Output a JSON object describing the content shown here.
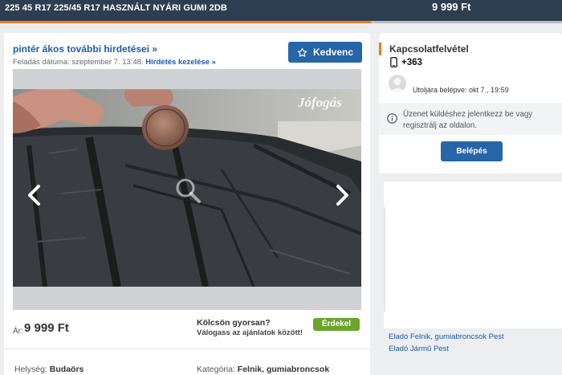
{
  "header": {
    "title": "225 45 R17 225/45 R17 HASZNÁLT NYÁRI GUMI 2DB",
    "price": "9 999 Ft"
  },
  "ad": {
    "seller_link": "pintér ákos további hirdetései »",
    "posted_label": "Feladás dátuma: szeptember 7. 13:48.",
    "manage_link": "Hirdetés kezelése »",
    "favorite_label": "Kedvenc",
    "watermark": "Jófogás",
    "price_label": "Ár:",
    "price_value": "9 999 Ft",
    "loan_title": "Kölcsön gyorsan?",
    "loan_subtitle": "Válogass az ajánlatok között!",
    "interest_label": "Érdekel",
    "location_label": "Helység:",
    "location_value": "Budaörs",
    "category_label": "Kategória:",
    "category_value": "Felnik, gumiabroncsok"
  },
  "contact": {
    "title": "Kapcsolatfelvétel",
    "phone": "+363",
    "last_login": "Utoljára belépve: okt 7., 19:59",
    "info_text": "Üzenet küldéshez jelentkezz be vagy regisztrálj az oldalon.",
    "login_label": "Belépés"
  },
  "related": {
    "links": [
      "Eladó Felnik, gumiabroncsok Pest",
      "Eladó Jármű Pest"
    ]
  },
  "colors": {
    "topbar": "#2c3e50",
    "accent_orange": "#ef7d22",
    "primary_blue": "#2565a8",
    "link_blue": "#1e5ba8",
    "green_button": "#6aa52c"
  },
  "icons": {
    "favorite": "star-icon",
    "phone": "phone-icon",
    "info": "info-icon",
    "zoom": "search-icon",
    "prev": "chevron-left-icon",
    "next": "chevron-right-icon"
  }
}
